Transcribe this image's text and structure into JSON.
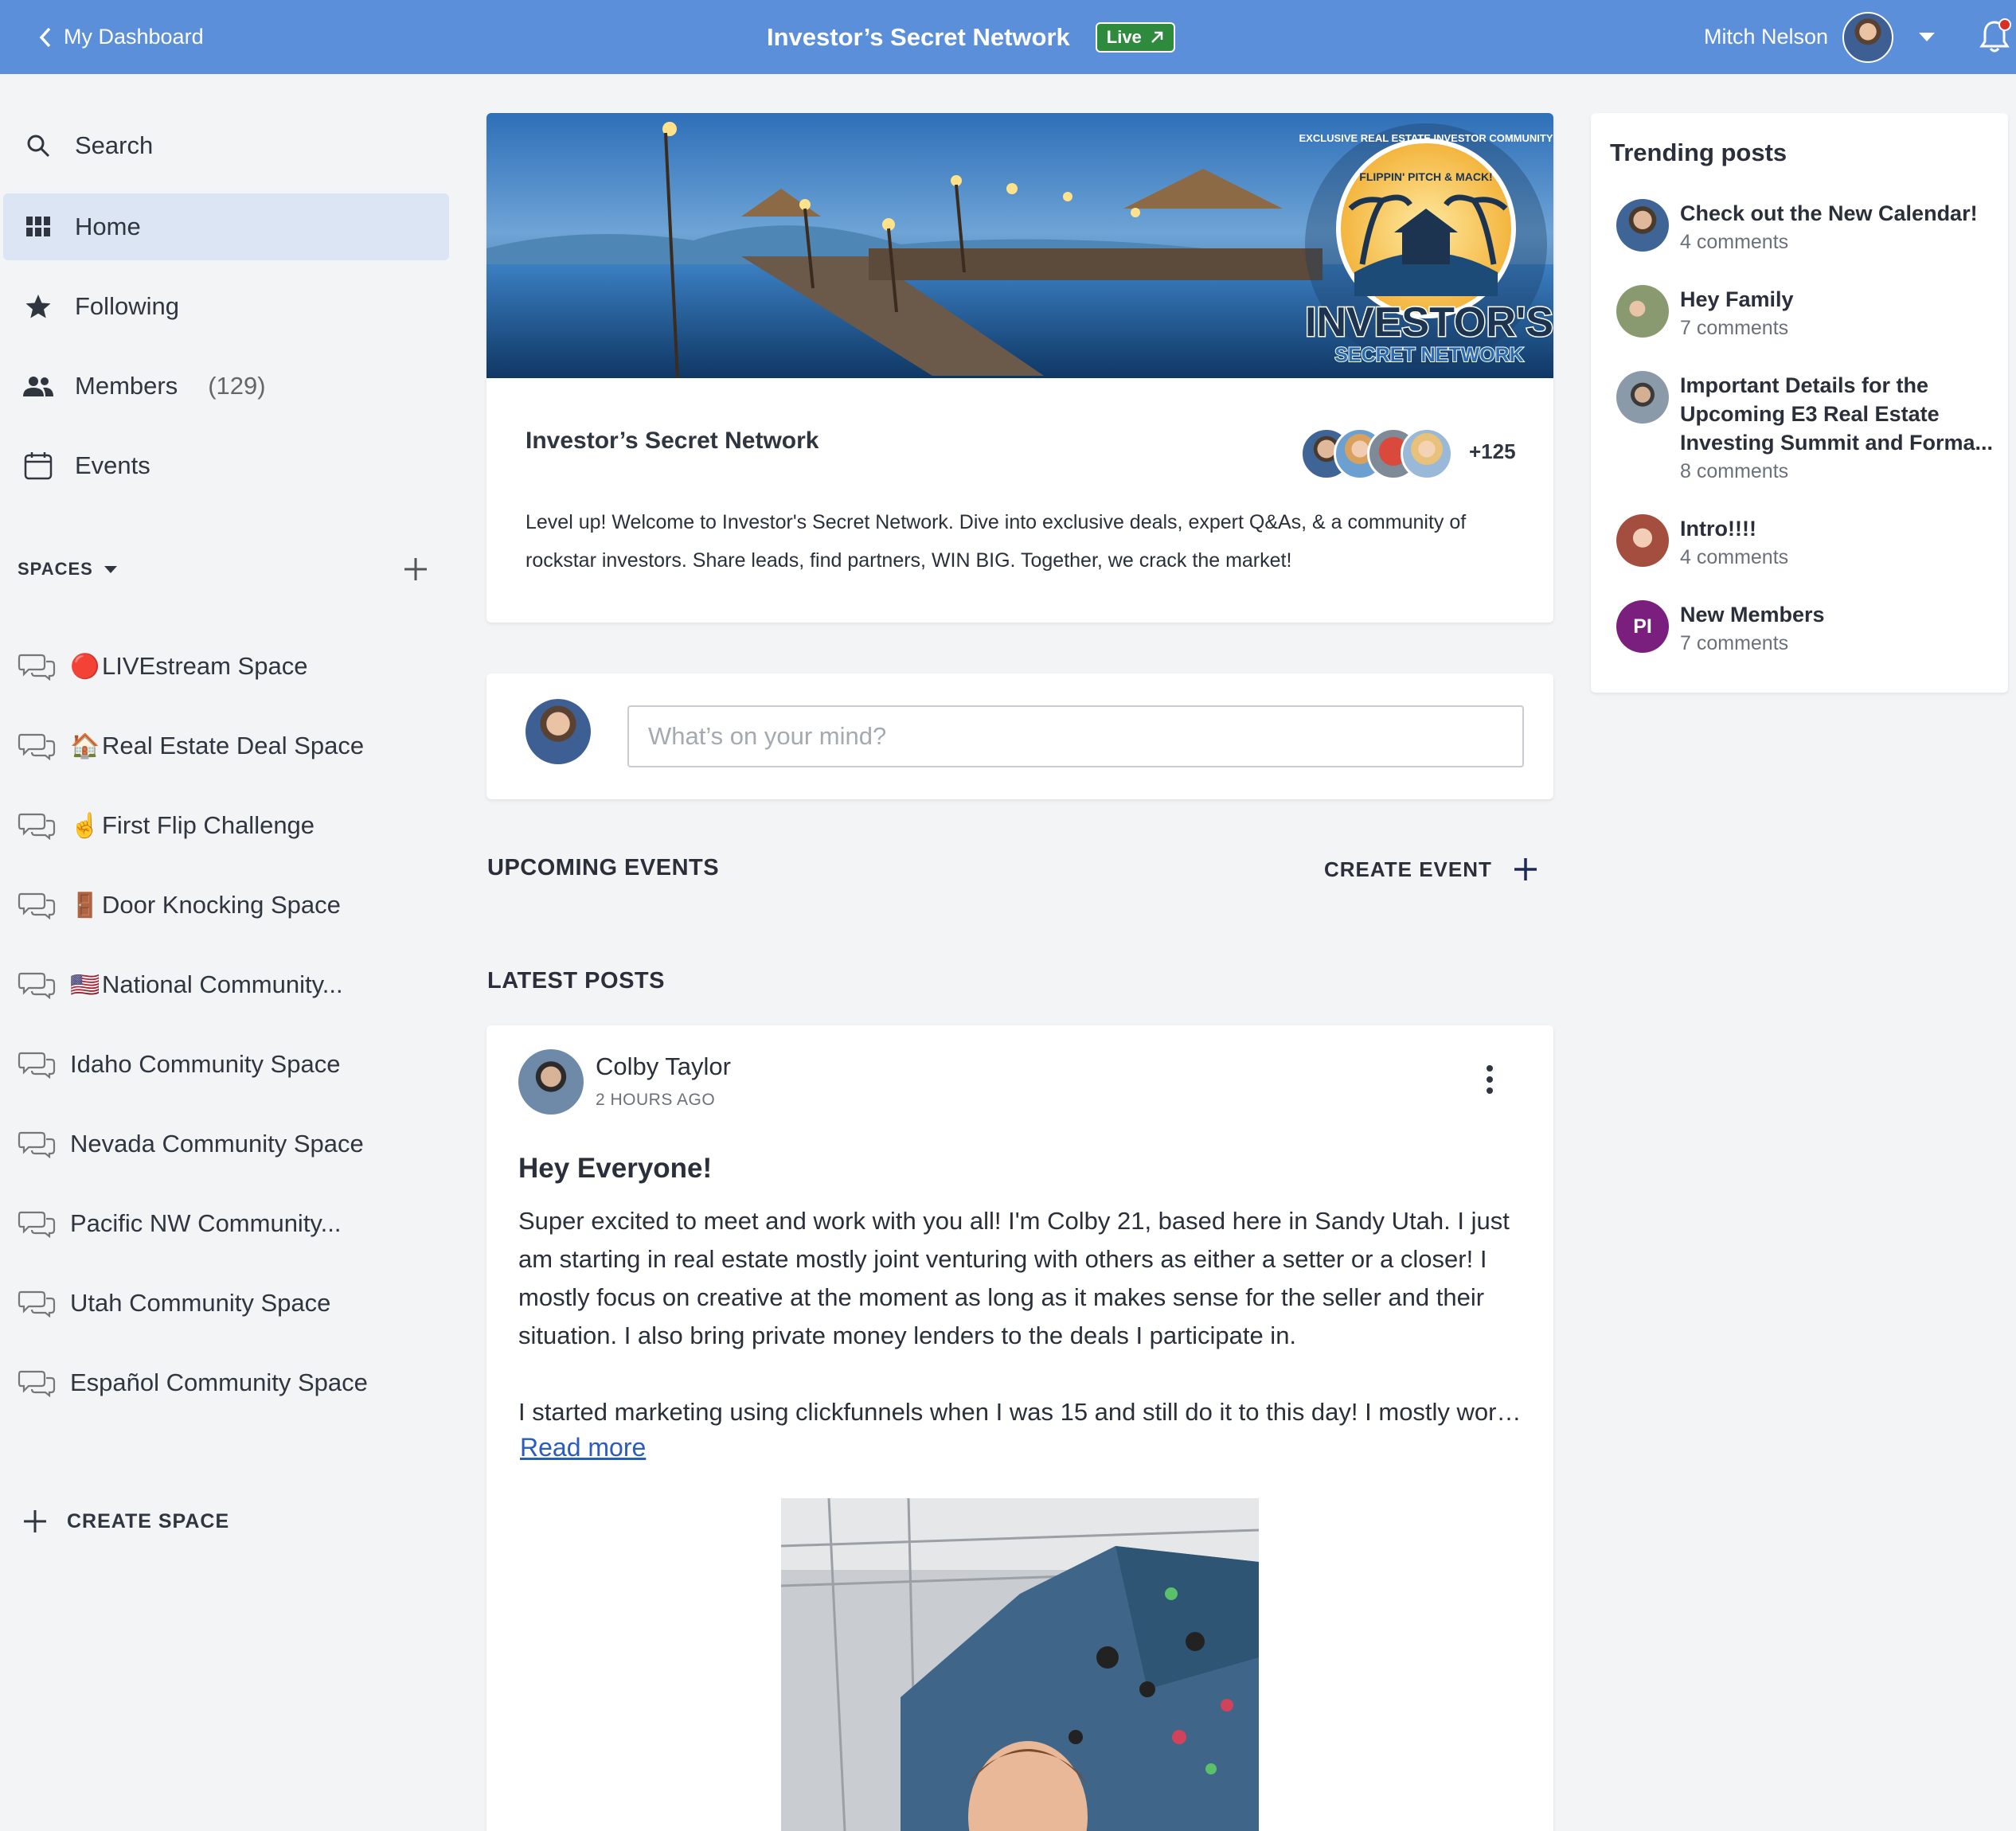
{
  "topbar": {
    "back_label": "My Dashboard",
    "title": "Investor’s Secret Network",
    "live_label": "Live",
    "user_name": "Mitch Nelson"
  },
  "sidebar": {
    "nav": [
      {
        "label": "Search",
        "icon": "search-icon"
      },
      {
        "label": "Home",
        "icon": "grid-icon",
        "active": true
      },
      {
        "label": "Following",
        "icon": "star-icon"
      },
      {
        "label": "Members",
        "icon": "people-icon",
        "count": "(129)"
      },
      {
        "label": "Events",
        "icon": "calendar-icon"
      }
    ],
    "spaces_label": "SPACES",
    "spaces": [
      {
        "emoji": "🔴",
        "label": "LIVEstream Space"
      },
      {
        "emoji": "🏠",
        "label": "Real Estate Deal Space"
      },
      {
        "emoji": "☝️",
        "label": "First Flip Challenge"
      },
      {
        "emoji": "🚪",
        "label": "Door Knocking Space"
      },
      {
        "emoji": "🇺🇸",
        "label": "National Community..."
      },
      {
        "emoji": "",
        "label": "Idaho Community Space"
      },
      {
        "emoji": "",
        "label": "Nevada Community Space"
      },
      {
        "emoji": "",
        "label": "Pacific NW Community..."
      },
      {
        "emoji": "",
        "label": "Utah Community Space"
      },
      {
        "emoji": "",
        "label": "Español Community Space"
      }
    ],
    "create_space_label": "CREATE SPACE"
  },
  "community": {
    "banner_logo_main": "INVESTOR'S",
    "banner_logo_sub": "SECRET NETWORK",
    "banner_logo_ring": "EXCLUSIVE REAL ESTATE INVESTOR COMMUNITY",
    "banner_logo_top": "FLIPPIN' PITCH & MACK!",
    "name": "Investor’s Secret Network",
    "member_more": "+125",
    "description": "Level up! Welcome to Investor's Secret Network. Dive into exclusive deals, expert Q&As, & a community of rockstar investors. Share leads, find partners, WIN BIG. Together, we crack the market!"
  },
  "composer": {
    "placeholder": "What’s on your mind?"
  },
  "events": {
    "title": "UPCOMING EVENTS",
    "create_label": "CREATE EVENT"
  },
  "latest": {
    "title": "LATEST POSTS"
  },
  "post": {
    "author": "Colby Taylor",
    "time": "2 HOURS AGO",
    "title": "Hey Everyone!",
    "paragraph1": "Super excited to meet and work with you all! I'm Colby 21, based here in Sandy Utah. I just am starting in real estate mostly joint venturing with others as either a setter or a closer! I mostly focus on creative at the moment as long as it makes sense for the seller and their situation. I also bring private money lenders to the deals I participate in.",
    "paragraph2": "I started marketing using clickfunnels when I was 15 and still do it to this day! I mostly work …",
    "read_more": "Read more"
  },
  "trending": {
    "title": "Trending posts",
    "items": [
      {
        "title": "Check out the New Calendar!",
        "comments": "4 comments"
      },
      {
        "title": "Hey Family",
        "comments": "7 comments"
      },
      {
        "title": "Important Details for the Upcoming E3 Real Estate Investing Summit and Forma...",
        "comments": "8 comments"
      },
      {
        "title": "Intro!!!!",
        "comments": "4 comments"
      },
      {
        "title": "New Members",
        "comments": "7 comments",
        "initials": "PI"
      }
    ]
  },
  "colors": {
    "topbar": "#5b8fd9",
    "live": "#2e8b3e",
    "active_nav": "#dbe5f3",
    "link": "#2a5bbf",
    "pi_avatar": "#7b1f7e"
  }
}
